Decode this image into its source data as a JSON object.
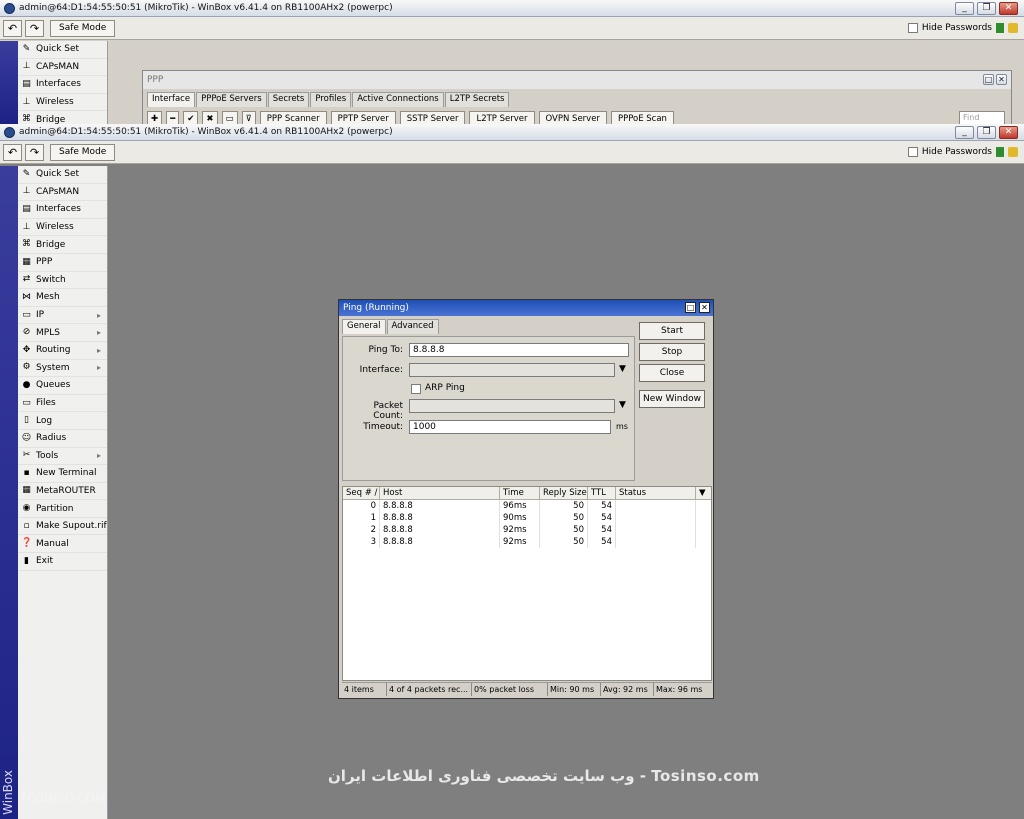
{
  "window_title": "admin@64:D1:54:55:50:51 (MikroTik) - WinBox v6.41.4 on RB1100AHx2 (powerpc)",
  "toolbar": {
    "safe_mode": "Safe Mode",
    "hide_passwords": "Hide Passwords"
  },
  "sidebar_brand": "WinBox",
  "menu_top": [
    "Quick Set",
    "CAPsMAN",
    "Interfaces",
    "Wireless",
    "Bridge"
  ],
  "menu": [
    {
      "label": "Quick Set",
      "icon": "quick-set-icon",
      "glyph": "✎"
    },
    {
      "label": "CAPsMAN",
      "icon": "capsman-icon",
      "glyph": "⊥"
    },
    {
      "label": "Interfaces",
      "icon": "interfaces-icon",
      "glyph": "▤"
    },
    {
      "label": "Wireless",
      "icon": "wireless-icon",
      "glyph": "⊥"
    },
    {
      "label": "Bridge",
      "icon": "bridge-icon",
      "glyph": "⌘"
    },
    {
      "label": "PPP",
      "icon": "ppp-icon",
      "glyph": "▦"
    },
    {
      "label": "Switch",
      "icon": "switch-icon",
      "glyph": "⇄"
    },
    {
      "label": "Mesh",
      "icon": "mesh-icon",
      "glyph": "⋈"
    },
    {
      "label": "IP",
      "icon": "ip-icon",
      "glyph": "▭",
      "submenu": true
    },
    {
      "label": "MPLS",
      "icon": "mpls-icon",
      "glyph": "⊘",
      "submenu": true
    },
    {
      "label": "Routing",
      "icon": "routing-icon",
      "glyph": "✥",
      "submenu": true
    },
    {
      "label": "System",
      "icon": "system-icon",
      "glyph": "⚙",
      "submenu": true
    },
    {
      "label": "Queues",
      "icon": "queues-icon",
      "glyph": "●"
    },
    {
      "label": "Files",
      "icon": "files-icon",
      "glyph": "▭"
    },
    {
      "label": "Log",
      "icon": "log-icon",
      "glyph": "▯"
    },
    {
      "label": "Radius",
      "icon": "radius-icon",
      "glyph": "☺"
    },
    {
      "label": "Tools",
      "icon": "tools-icon",
      "glyph": "✂",
      "submenu": true
    },
    {
      "label": "New Terminal",
      "icon": "terminal-icon",
      "glyph": "▪"
    },
    {
      "label": "MetaROUTER",
      "icon": "metarouter-icon",
      "glyph": "▦"
    },
    {
      "label": "Partition",
      "icon": "partition-icon",
      "glyph": "◉"
    },
    {
      "label": "Make Supout.rif",
      "icon": "supout-icon",
      "glyph": "▫"
    },
    {
      "label": "Manual",
      "icon": "manual-icon",
      "glyph": "❓"
    },
    {
      "label": "Exit",
      "icon": "exit-icon",
      "glyph": "▮"
    }
  ],
  "ppp": {
    "title": "PPP",
    "tabs": [
      "Interface",
      "PPPoE Servers",
      "Secrets",
      "Profiles",
      "Active Connections",
      "L2TP Secrets"
    ],
    "buttons": [
      "PPP Scanner",
      "PPTP Server",
      "SSTP Server",
      "L2TP Server",
      "OVPN Server",
      "PPPoE Scan"
    ],
    "find_placeholder": "Find"
  },
  "ping": {
    "title": "Ping (Running)",
    "tabs": [
      "General",
      "Advanced"
    ],
    "labels": {
      "ping_to": "Ping To:",
      "interface": "Interface:",
      "arp_ping": "ARP Ping",
      "packet_count": "Packet Count:",
      "timeout": "Timeout:",
      "ms": "ms"
    },
    "values": {
      "ping_to": "8.8.8.8",
      "interface": "",
      "packet_count": "",
      "timeout": "1000"
    },
    "buttons": [
      "Start",
      "Stop",
      "Close",
      "New Window"
    ],
    "columns": [
      "Seq # /",
      "Host",
      "Time",
      "Reply Size",
      "TTL",
      "Status"
    ],
    "rows": [
      [
        "0",
        "8.8.8.8",
        "96ms",
        "50",
        "54",
        ""
      ],
      [
        "1",
        "8.8.8.8",
        "90ms",
        "50",
        "54",
        ""
      ],
      [
        "2",
        "8.8.8.8",
        "92ms",
        "50",
        "54",
        ""
      ],
      [
        "3",
        "8.8.8.8",
        "92ms",
        "50",
        "54",
        ""
      ]
    ],
    "status": [
      "4 items",
      "4 of 4 packets rec...",
      "0% packet loss",
      "Min: 90 ms",
      "Avg: 92 ms",
      "Max: 96 ms"
    ]
  },
  "watermark": "وب سایت تخصصی فناوری اطلاعات ایران - Tosinso.com",
  "watermark2": "TOSINSO.COM"
}
